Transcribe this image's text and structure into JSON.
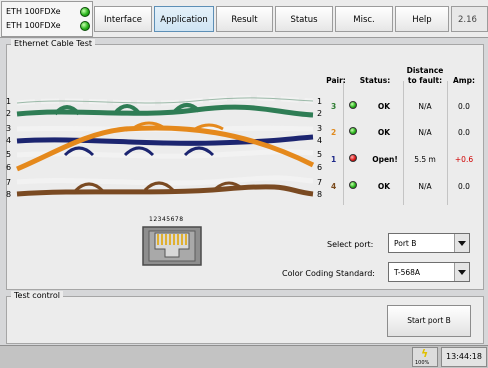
{
  "header": {
    "ports": [
      "ETH 100FDXe",
      "ETH 100FDXe"
    ],
    "tabs": [
      "Interface",
      "Application",
      "Result",
      "Status",
      "Misc.",
      "Help"
    ],
    "active_tab": "Application",
    "time_tab": "2.16"
  },
  "cable_test": {
    "title": "Ethernet Cable Test",
    "wire_numbers_left": [
      "1",
      "2",
      "3",
      "4",
      "5",
      "6",
      "7",
      "8"
    ],
    "wire_numbers_right": [
      "1",
      "2",
      "3",
      "4",
      "5",
      "6",
      "7",
      "8"
    ],
    "columns": {
      "pair": "Pair:",
      "status": "Status:",
      "distance_line1": "Distance",
      "distance_line2": "to fault:",
      "amp": "Amp:"
    },
    "rows": [
      {
        "pair": "3",
        "pair_color": "#2e7d32",
        "led": "green",
        "status": "OK",
        "distance": "N/A",
        "amp": "0.0",
        "amp_color": "#000000"
      },
      {
        "pair": "2",
        "pair_color": "#e08a1e",
        "led": "green",
        "status": "OK",
        "distance": "N/A",
        "amp": "0.0",
        "amp_color": "#000000"
      },
      {
        "pair": "1",
        "pair_color": "#1f2a8a",
        "led": "red",
        "status": "Open!",
        "distance": "5.5 m",
        "amp": "+0.6",
        "amp_color": "#d00000"
      },
      {
        "pair": "4",
        "pair_color": "#7a4a1c",
        "led": "green",
        "status": "OK",
        "distance": "N/A",
        "amp": "0.0",
        "amp_color": "#000000"
      }
    ],
    "connector_pins": "12345678",
    "select_port_label": "Select port:",
    "select_port_value": "Port B",
    "color_coding_label": "Color Coding Standard:",
    "color_coding_value": "T-568A"
  },
  "test_control": {
    "title": "Test control",
    "start_button": "Start port B"
  },
  "status_bar": {
    "battery_label": "100%",
    "time": "13:44:18"
  },
  "colors": {
    "green_pair": "#2f7d55",
    "orange_pair": "#e5891c",
    "blue_pair": "#1c2570",
    "brown_pair": "#7a4a22",
    "accent": "#5d8fb6"
  }
}
